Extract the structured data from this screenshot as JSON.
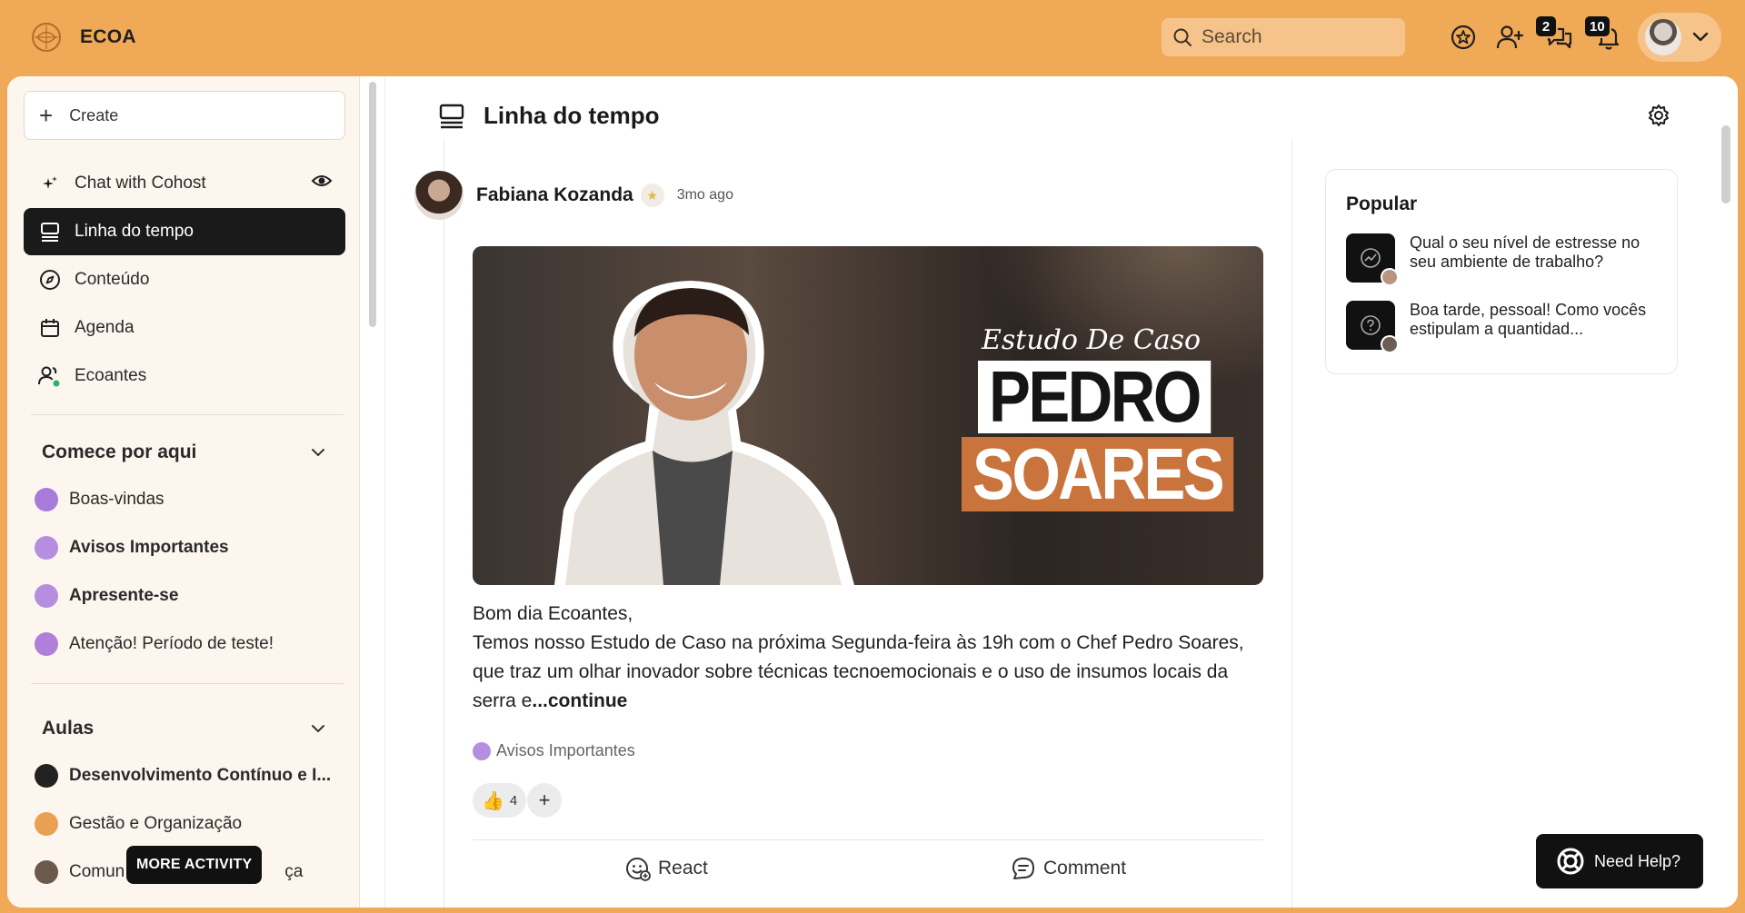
{
  "topbar": {
    "brand": "ECOA",
    "search_placeholder": "Search",
    "chat_badge": "2",
    "notif_badge": "10"
  },
  "sidebar": {
    "create_label": "Create",
    "nav": [
      {
        "label": "Chat with Cohost",
        "icon": "sparkle-icon"
      },
      {
        "label": "Linha do tempo",
        "icon": "timeline-icon",
        "active": true
      },
      {
        "label": "Conteúdo",
        "icon": "compass-icon"
      },
      {
        "label": "Agenda",
        "icon": "calendar-icon"
      },
      {
        "label": "Ecoantes",
        "icon": "members-icon"
      }
    ],
    "sections": [
      {
        "title": "Comece por aqui",
        "items": [
          {
            "label": "Boas-vindas",
            "color": "#A77BD8",
            "bold": false
          },
          {
            "label": "Avisos Importantes",
            "color": "#B58EE0",
            "bold": true
          },
          {
            "label": "Apresente-se",
            "color": "#B58EE0",
            "bold": true
          },
          {
            "label": "Atenção! Período de teste!",
            "color": "#B07FDA",
            "bold": false
          }
        ]
      },
      {
        "title": "Aulas",
        "items": [
          {
            "label": "Desenvolvimento Contínuo e I...",
            "color": "#222222",
            "bold": true
          },
          {
            "label": "Gestão e Organização",
            "color": "#E9A055",
            "bold": false
          },
          {
            "label": "Comun",
            "tail": "ça",
            "color": "#6b5a4c",
            "bold": false
          }
        ]
      }
    ],
    "tooltip": "MORE ACTIVITY"
  },
  "main": {
    "page_title": "Linha do tempo",
    "post": {
      "author": "Fabiana Kozanda",
      "time": "3mo ago",
      "image": {
        "label_small": "Estudo De Caso",
        "label_line1": "PEDRO",
        "label_line2": "SOARES"
      },
      "body_line1": "Bom dia Ecoantes,",
      "body_line2": "Temos nosso Estudo de Caso na próxima Segunda-feira às 19h com o Chef Pedro Soares, que traz um olhar inovador sobre técnicas tecnoemocionais e o uso de insumos locais da serra e",
      "continue": "...continue",
      "space": "Avisos Importantes",
      "reaction_count": "4",
      "react_label": "React",
      "comment_label": "Comment"
    }
  },
  "popular": {
    "title": "Popular",
    "items": [
      {
        "text": "Qual o seu nível de estresse no seu ambiente de trabalho?",
        "icon": "chart-icon"
      },
      {
        "text": "Boa tarde, pessoal! Como vocês estipulam a quantidad...",
        "icon": "question-icon"
      }
    ]
  },
  "help": {
    "label": "Need Help?"
  },
  "colors": {
    "brand": "#F0A956",
    "active_nav": "#1A1A1A",
    "accent_orange": "#C8743C"
  }
}
